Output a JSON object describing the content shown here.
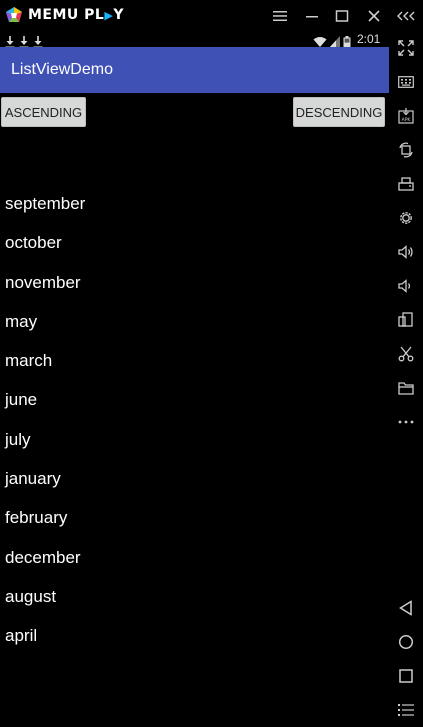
{
  "emulator": {
    "brand_left": "MEMU PL",
    "brand_right": "Y",
    "icons": [
      "menu-icon",
      "minimize-icon",
      "maximize-icon",
      "close-icon",
      "collapse-icon"
    ],
    "sidebar_icons": [
      "fullscreen-icon",
      "keyboard-icon",
      "apk-icon",
      "rotate-icon",
      "screenshot-icon",
      "settings-icon",
      "volume-up-icon",
      "volume-down-icon",
      "multi-window-icon",
      "scissors-icon",
      "folder-icon",
      "more-icon",
      "back-icon",
      "home-icon",
      "recents-icon",
      "list-icon"
    ]
  },
  "status_bar": {
    "time": "2:01",
    "notification_icons": [
      "download-icon",
      "download-icon",
      "download-icon"
    ]
  },
  "app": {
    "title": "ListViewDemo",
    "accent_color": "#3f51b5"
  },
  "buttons": {
    "ascending": "ASCENDING",
    "descending": "DESCENDING"
  },
  "months": [
    {
      "label": "september"
    },
    {
      "label": "october"
    },
    {
      "label": "november"
    },
    {
      "label": "may"
    },
    {
      "label": "march"
    },
    {
      "label": "june"
    },
    {
      "label": "july"
    },
    {
      "label": "january"
    },
    {
      "label": "february"
    },
    {
      "label": "december"
    },
    {
      "label": "august"
    },
    {
      "label": "april"
    }
  ]
}
